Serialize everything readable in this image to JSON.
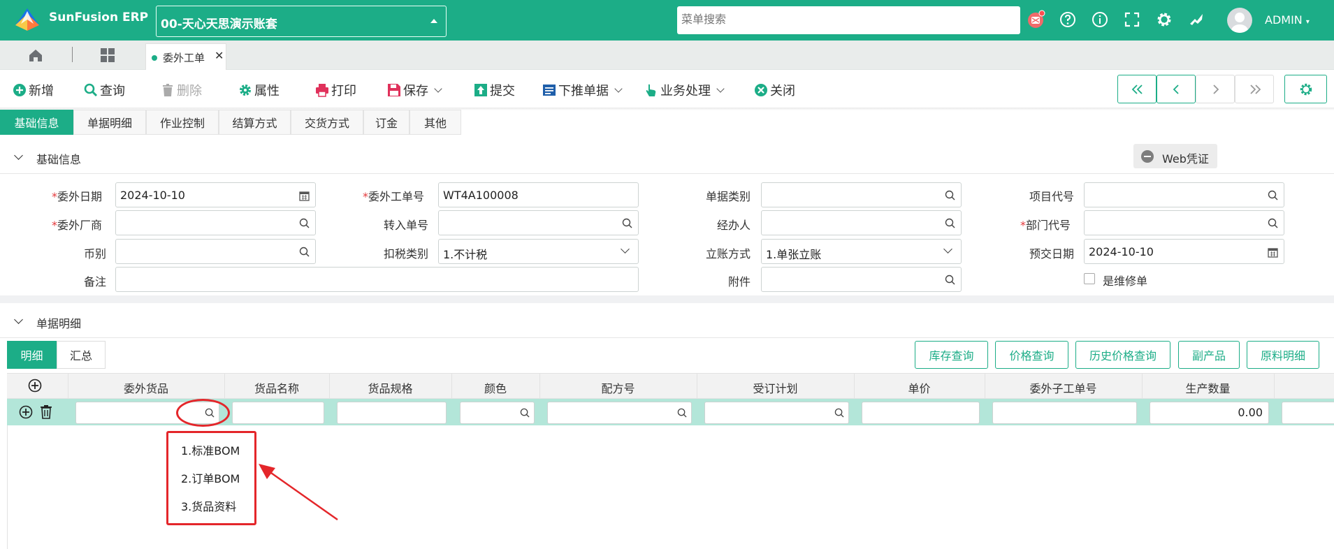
{
  "app": {
    "title": "SunFusion ERP",
    "account": "00-天心天思演示账套",
    "search_placeholder": "菜单搜索",
    "user": "ADMIN"
  },
  "tabs": {
    "active_tab": "委外工单"
  },
  "toolbar": {
    "new": "新增",
    "query": "查询",
    "delete": "删除",
    "properties": "属性",
    "print": "打印",
    "save": "保存",
    "submit": "提交",
    "push_down": "下推单据",
    "business": "业务处理",
    "close": "关闭"
  },
  "form_tabs": [
    "基础信息",
    "单据明细",
    "作业控制",
    "结算方式",
    "交货方式",
    "订金",
    "其他"
  ],
  "basic": {
    "section_title": "基础信息",
    "web_voucher": "Web凭证",
    "fields": {
      "outsource_date": {
        "label": "委外日期",
        "value": "2024-10-10"
      },
      "outsource_no": {
        "label": "委外工单号",
        "value": "WT4A100008"
      },
      "doc_type": {
        "label": "单据类别",
        "value": ""
      },
      "project_code": {
        "label": "项目代号",
        "value": ""
      },
      "vendor": {
        "label": "委外厂商",
        "value": ""
      },
      "transfer_no": {
        "label": "转入单号",
        "value": ""
      },
      "handler": {
        "label": "经办人",
        "value": ""
      },
      "dept_code": {
        "label": "部门代号",
        "value": ""
      },
      "currency": {
        "label": "币别",
        "value": ""
      },
      "tax_type": {
        "label": "扣税类别",
        "value": "1.不计税"
      },
      "account_method": {
        "label": "立账方式",
        "value": "1.单张立账"
      },
      "delivery_date": {
        "label": "预交日期",
        "value": "2024-10-10"
      },
      "remark": {
        "label": "备注",
        "value": ""
      },
      "attachment": {
        "label": "附件",
        "value": ""
      },
      "is_repair": {
        "label": "是维修单",
        "checked": false
      }
    }
  },
  "detail": {
    "section_title": "单据明细",
    "subtabs": [
      "明细",
      "汇总"
    ],
    "buttons": [
      "库存查询",
      "价格查询",
      "历史价格查询",
      "副产品",
      "原料明细"
    ],
    "columns": [
      "委外货品",
      "货品名称",
      "货品规格",
      "颜色",
      "配方号",
      "受订计划",
      "单价",
      "委外子工单号",
      "生产数量"
    ],
    "row": {
      "quantity": "0.00"
    },
    "popup_options": [
      "1.标准BOM",
      "2.订单BOM",
      "3.货品资料"
    ]
  },
  "colors": {
    "brand": "#1cad87",
    "highlight": "#e4262a"
  }
}
